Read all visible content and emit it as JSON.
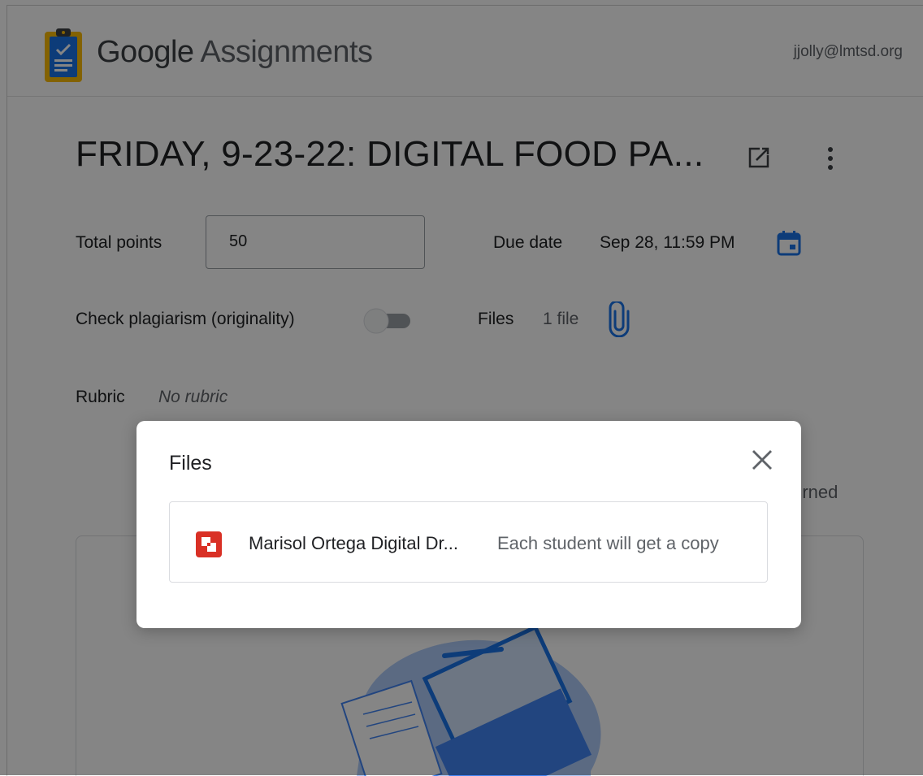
{
  "header": {
    "brand_google": "Google",
    "brand_product": "Assignments",
    "account": "jjolly@lmtsd.org"
  },
  "assignment": {
    "title": "FRIDAY, 9-23-22: DIGITAL FOOD PA...",
    "total_points_label": "Total points",
    "total_points_value": "50",
    "due_date_label": "Due date",
    "due_date_value": "Sep 28, 11:59 PM",
    "plagiarism_label": "Check plagiarism (originality)",
    "plagiarism_enabled": false,
    "files_label": "Files",
    "files_count": "1 file",
    "rubric_label": "Rubric",
    "rubric_value": "No rubric",
    "partial_status": "turned"
  },
  "dialog": {
    "title": "Files",
    "files": [
      {
        "name": "Marisol Ortega Digital Dr...",
        "note": "Each student will get a copy",
        "icon": "slides-file-icon"
      }
    ]
  },
  "colors": {
    "accent_blue": "#1a73e8",
    "file_icon_red": "#d93025",
    "scrim": "rgba(0,0,0,0.48)"
  }
}
